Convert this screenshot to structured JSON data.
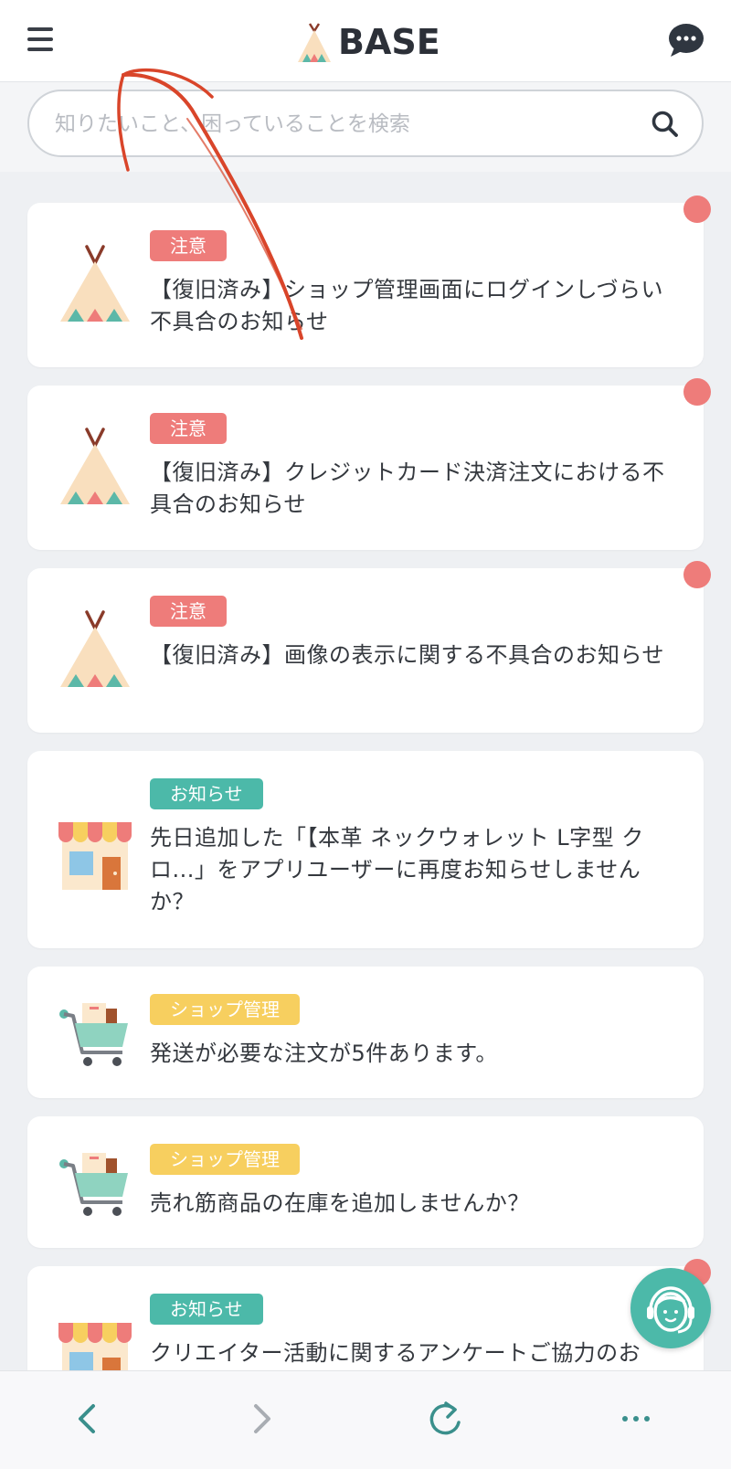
{
  "header": {
    "logo_text": "BASE"
  },
  "search": {
    "placeholder": "知りたいこと、困っていることを検索"
  },
  "cards": [
    {
      "tag": "注意",
      "title": "【復旧済み】ショップ管理画面にログインしづらい不具合のお知らせ"
    },
    {
      "tag": "注意",
      "title": "【復旧済み】クレジットカード決済注文における不具合のお知らせ"
    },
    {
      "tag": "注意",
      "title": "【復旧済み】画像の表示に関する不具合のお知らせ"
    },
    {
      "tag": "お知らせ",
      "title": "先日追加した「【本革 ネックウォレット L字型 クロ...」をアプリユーザーに再度お知らせしませんか？"
    },
    {
      "tag": "ショップ管理",
      "title": "発送が必要な注文が5件あります。"
    },
    {
      "tag": "ショップ管理",
      "title": "売れ筋商品の在庫を追加しませんか？"
    },
    {
      "tag": "お知らせ",
      "title": "クリエイター活動に関するアンケートご協力のお"
    }
  ],
  "colors": {
    "warn": "#ee7c7a",
    "info": "#4cb9a9",
    "shop": "#f7cf5f",
    "unread_dot": "#ee7c7a",
    "annotation": "#d9452a"
  },
  "icons": {
    "menu": "hamburger-menu-icon",
    "chat": "chat-bubble-icon",
    "search": "search-icon",
    "tent": "tent-icon",
    "store": "store-icon",
    "cart": "cart-icon",
    "support": "support-agent-icon",
    "back": "back-arrow-icon",
    "forward": "forward-arrow-icon",
    "reload": "reload-icon",
    "more": "more-dots-icon"
  }
}
